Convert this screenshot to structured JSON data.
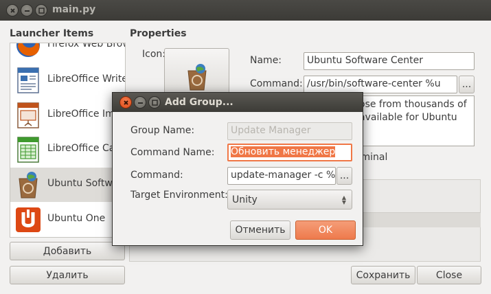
{
  "window": {
    "title": "main.py"
  },
  "launcher": {
    "heading": "Launcher Items",
    "items": [
      {
        "label": "Firefox Web Brow"
      },
      {
        "label": "LibreOffice Write"
      },
      {
        "label": "LibreOffice Im"
      },
      {
        "label": "LibreOffice Ca"
      },
      {
        "label": "Ubuntu Softw"
      },
      {
        "label": "Ubuntu One"
      }
    ],
    "add_label": "Добавить",
    "remove_label": "Удалить"
  },
  "properties": {
    "heading": "Properties",
    "icon_label": "Icon:",
    "name_label": "Name:",
    "name_value": "Ubuntu Software Center",
    "command_label": "Command:",
    "command_value": "/usr/bin/software-center %u",
    "browse_label": "...",
    "comment_line1": "ose from thousands of",
    "comment_line2": "available for Ubuntu",
    "terminal_label": "rminal"
  },
  "footer": {
    "save_label": "Сохранить",
    "close_label": "Close"
  },
  "dialog": {
    "title": "Add Group...",
    "group_name_label": "Group Name:",
    "group_name_placeholder": "Update Manager",
    "command_name_label": "Command Name:",
    "command_name_value": "Обновить менеджер",
    "command_label": "Command:",
    "command_value": "update-manager -c %u",
    "browse_label": "...",
    "target_env_label": "Target Environment:",
    "target_env_value": "Unity",
    "cancel_label": "Отменить",
    "ok_label": "OK"
  },
  "colors": {
    "accent": "#f07746",
    "selection": "#f07746",
    "titlebar": "#3c3b37"
  }
}
